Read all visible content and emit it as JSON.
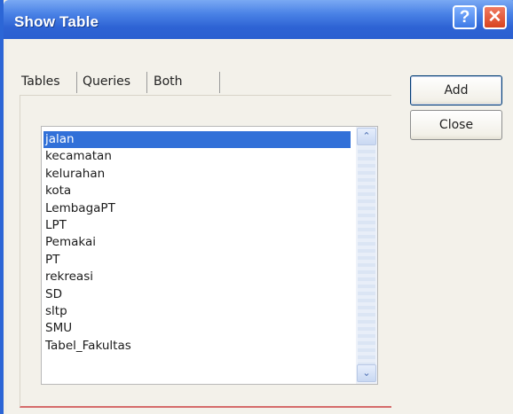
{
  "window": {
    "title": "Show Table",
    "help_symbol": "?",
    "close_symbol": "✕"
  },
  "tabs": [
    {
      "label": "Tables"
    },
    {
      "label": "Queries"
    },
    {
      "label": "Both"
    }
  ],
  "list": {
    "items": [
      "jalan",
      "kecamatan",
      "kelurahan",
      "kota",
      "LembagaPT",
      "LPT",
      "Pemakai",
      "PT",
      "rekreasi",
      "SD",
      "sltp",
      "SMU",
      "Tabel_Fakultas"
    ],
    "selected": "jalan"
  },
  "scrollbar": {
    "up_symbol": "⌃",
    "down_symbol": "⌄"
  },
  "buttons": {
    "add": "Add",
    "close": "Close"
  }
}
